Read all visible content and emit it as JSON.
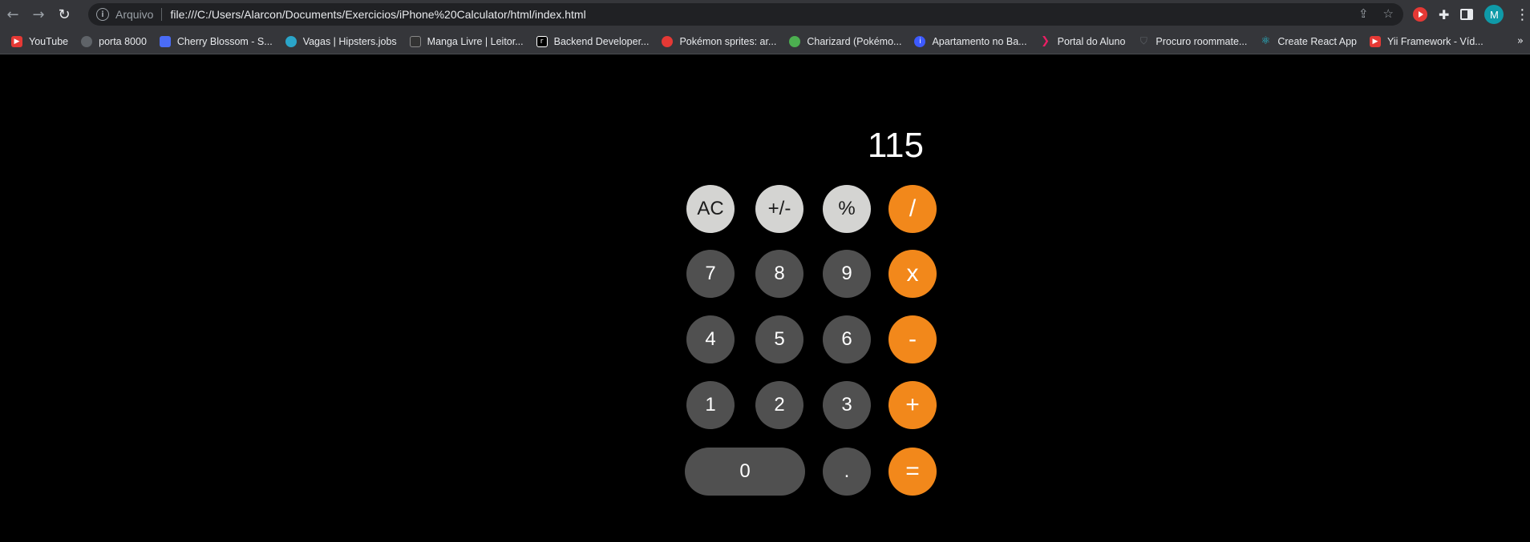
{
  "browser": {
    "origin_label": "Arquivo",
    "url": "file:///C:/Users/Alarcon/Documents/Exercicios/iPhone%20Calculator/html/index.html",
    "avatar_letter": "M"
  },
  "bookmarks": [
    {
      "label": "YouTube",
      "icon_color": "#e53935",
      "icon": "youtube-icon"
    },
    {
      "label": "porta 8000",
      "icon_color": "#5f6368",
      "icon": "globe-icon"
    },
    {
      "label": "Cherry Blossom - S...",
      "icon_color": "#4a6cf7",
      "icon": "cherry-icon"
    },
    {
      "label": "Vagas | Hipsters.jobs",
      "icon_color": "#2aa5c9",
      "icon": "hipsters-icon"
    },
    {
      "label": "Manga Livre | Leitor...",
      "icon_color": "#333333",
      "icon": "manga-icon"
    },
    {
      "label": "Backend Developer...",
      "icon_color": "#000000",
      "icon": "roadmap-icon"
    },
    {
      "label": "Pokémon sprites: ar...",
      "icon_color": "#e53935",
      "icon": "pokeball-icon"
    },
    {
      "label": "Charizard (Pokémo...",
      "icon_color": "#4caf50",
      "icon": "bulbapedia-icon"
    },
    {
      "label": "Apartamento no Ba...",
      "icon_color": "#3d5afe",
      "icon": "info-icon"
    },
    {
      "label": "Portal do Aluno",
      "icon_color": "#e91e63",
      "icon": "portal-icon"
    },
    {
      "label": "Procuro roommate...",
      "icon_color": "#5f6368",
      "icon": "shield-icon"
    },
    {
      "label": "Create React App",
      "icon_color": "#26c6da",
      "icon": "react-icon"
    },
    {
      "label": "Yii Framework - Víd...",
      "icon_color": "#e53935",
      "icon": "youtube-icon"
    }
  ],
  "calculator": {
    "display": "115",
    "keys": {
      "ac": "AC",
      "sign": "+/-",
      "percent": "%",
      "divide": "/",
      "seven": "7",
      "eight": "8",
      "nine": "9",
      "multiply": "x",
      "four": "4",
      "five": "5",
      "six": "6",
      "minus": "-",
      "one": "1",
      "two": "2",
      "three": "3",
      "plus": "+",
      "zero": "0",
      "decimal": ".",
      "equals": "="
    }
  }
}
